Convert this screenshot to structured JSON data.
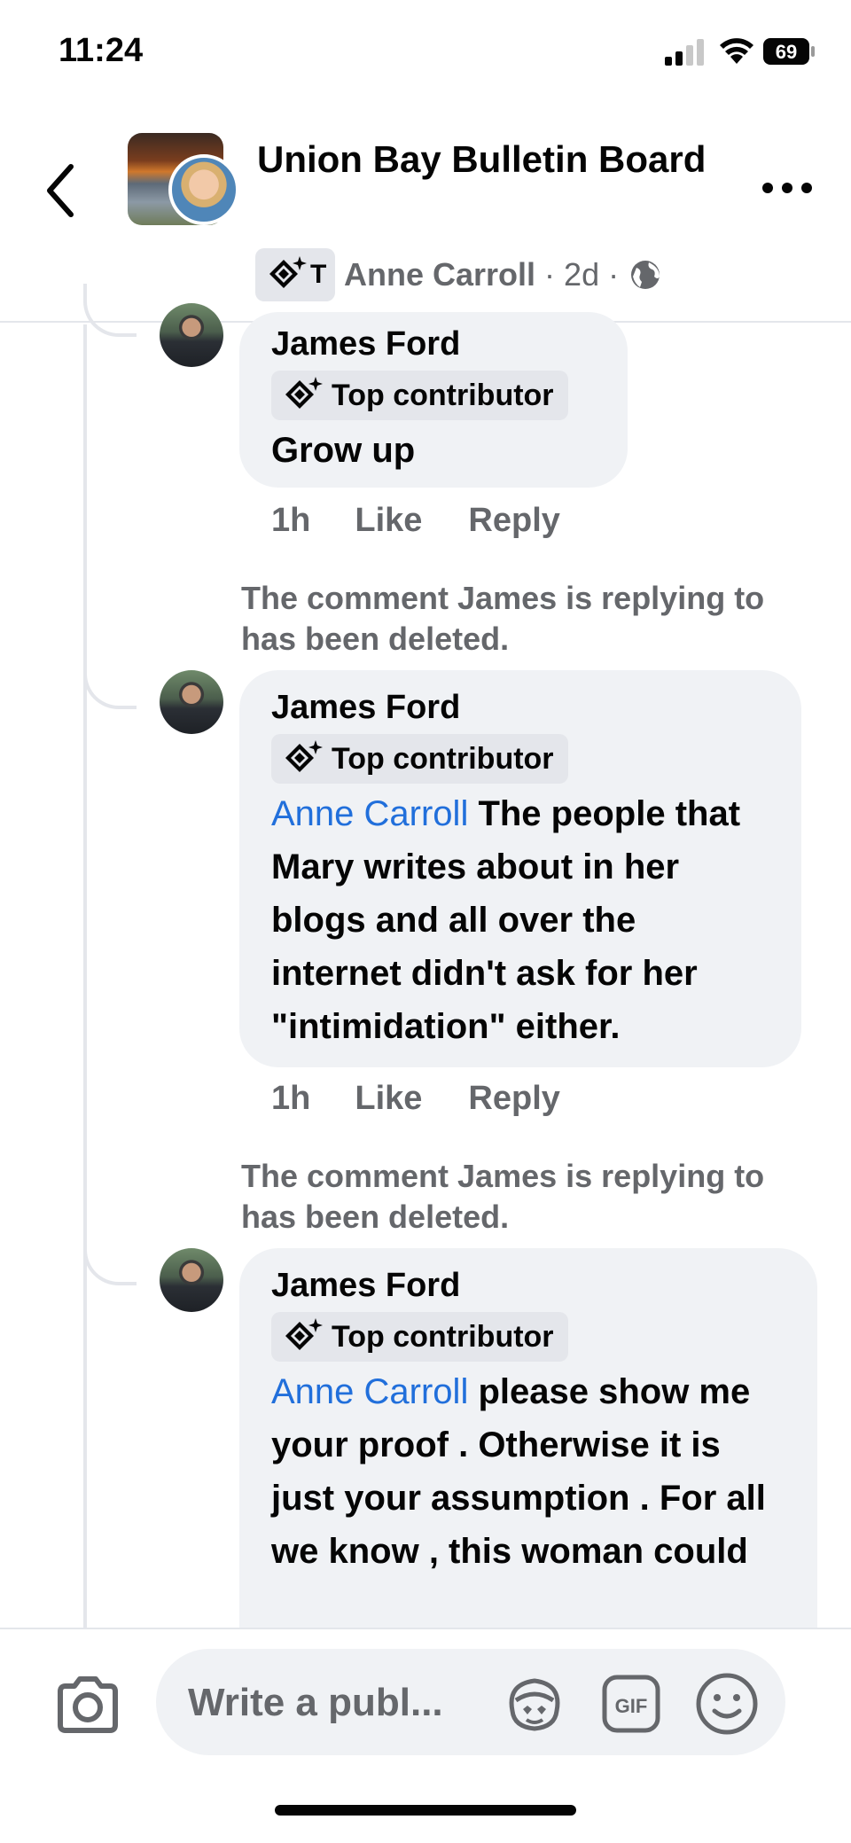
{
  "status_bar": {
    "time": "11:24",
    "battery": "69"
  },
  "header": {
    "group_name": "Union Bay Bulletin Board",
    "badge_letter": "T",
    "poster_name": "Anne Carroll",
    "post_age": "2d",
    "dot": "·"
  },
  "comments": [
    {
      "author": "James Ford",
      "badge": "Top contributor",
      "mention": "",
      "text": "Grow up",
      "time": "1h",
      "like": "Like",
      "reply": "Reply"
    },
    {
      "deleted_note": "The comment James is replying to has been deleted.",
      "author": "James Ford",
      "badge": "Top contributor",
      "mention": "Anne Carroll",
      "text": " The people that Mary writes about in her blogs and all over the internet didn't ask for her \"intimidation\" either.",
      "time": "1h",
      "like": "Like",
      "reply": "Reply"
    },
    {
      "deleted_note": "The comment James is replying to has been deleted.",
      "author": "James Ford",
      "badge": "Top contributor",
      "mention": "Anne Carroll",
      "text": " please show me your proof . Otherwise it is just your assumption  . For all we know , this woman could"
    }
  ],
  "composer": {
    "placeholder": "Write a publ..."
  },
  "colors": {
    "accent": "#216fdb",
    "bubble": "#f0f2f5",
    "muted": "#65676b"
  },
  "icons": [
    "back-icon",
    "more-icon",
    "top-contributor-icon",
    "globe-icon",
    "camera-icon",
    "avatar-sticker-icon",
    "gif-icon",
    "emoji-icon"
  ]
}
